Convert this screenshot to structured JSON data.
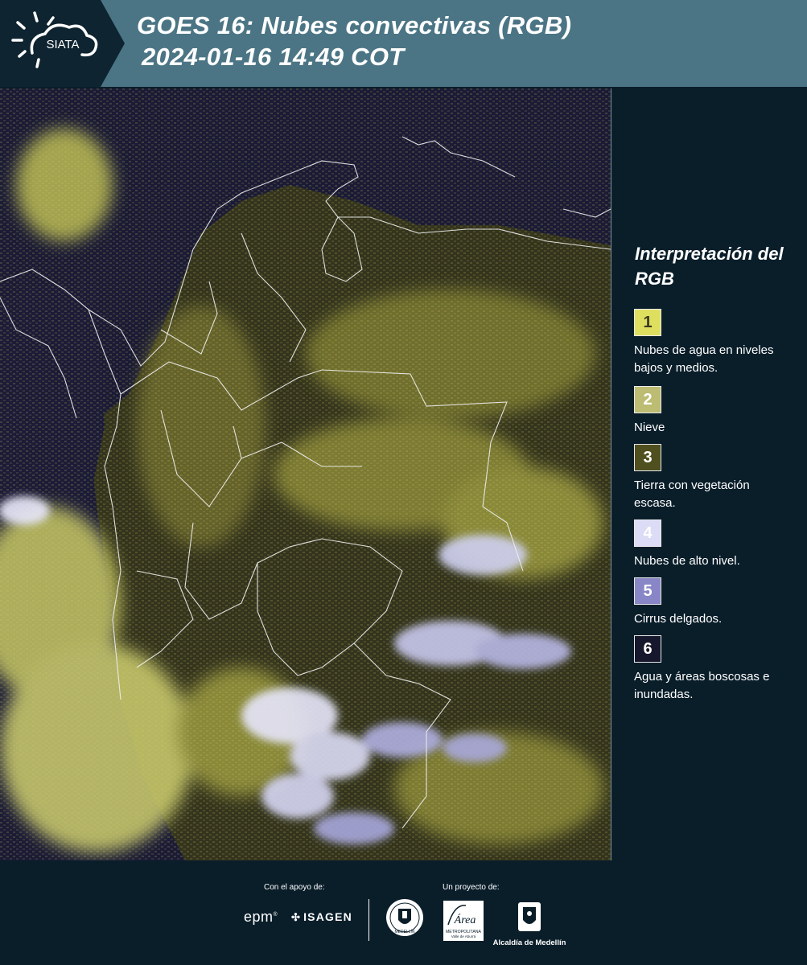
{
  "header": {
    "logo_text": "SIATA",
    "title_line1": "GOES 16: Nubes convectivas (RGB)",
    "title_line2": "2024-01-16 14:49 COT",
    "background_color": "#4b7585"
  },
  "map": {
    "description_icon": "satellite-rgb-image",
    "land_color": "#3a3a22",
    "ocean_color": "#1b1b34",
    "low_cloud_color": "#d8d86a",
    "high_cloud_color": "#e6e6ff"
  },
  "legend": {
    "title": "Interpretación del RGB",
    "items": [
      {
        "number": "1",
        "label": "Nubes de agua en niveles bajos y medios.",
        "color": "#dfdf5f",
        "text_color": "#3a3a22"
      },
      {
        "number": "2",
        "label": "Nieve",
        "color": "#bcbc72",
        "text_color": "#ffffff"
      },
      {
        "number": "3",
        "label": "Tierra con vegetación escasa.",
        "color": "#4f4f1f",
        "text_color": "#ffffff"
      },
      {
        "number": "4",
        "label": "Nubes de alto nivel.",
        "color": "#dcdcf6",
        "text_color": "#ffffff"
      },
      {
        "number": "5",
        "label": "Cirrus delgados.",
        "color": "#8886c6",
        "text_color": "#ffffff"
      },
      {
        "number": "6",
        "label": "Agua y áreas boscosas e inundadas.",
        "color": "#16162c",
        "text_color": "#ffffff"
      }
    ]
  },
  "footer": {
    "support_caption": "Con el apoyo de:",
    "project_caption": "Un proyecto de:",
    "epm_label": "epm",
    "isagen_label": "ISAGEN",
    "area_label_1": "Área",
    "area_label_2": "METROPOLITANA",
    "area_label_3": "Valle de Aburrá",
    "alcaldia_label": "Alcaldía de Medellín",
    "seal_label": "MEDELLÍN"
  }
}
